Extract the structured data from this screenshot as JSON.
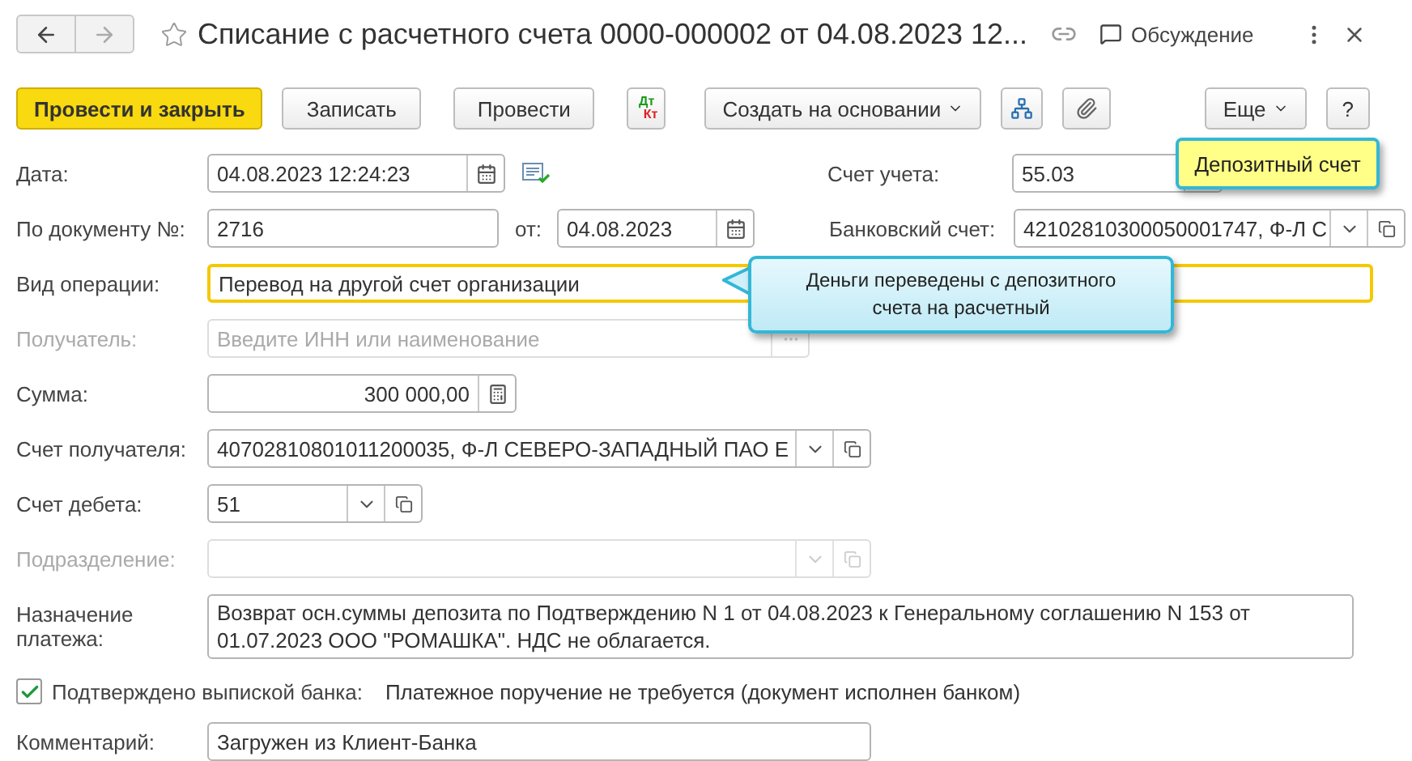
{
  "header": {
    "title": "Списание с расчетного счета 0000-000002 от 04.08.2023 12...",
    "discussion": "Обсуждение"
  },
  "toolbar": [
    {
      "kind": "primary",
      "label": "Провести и закрыть"
    },
    {
      "kind": "text",
      "label": "Записать"
    },
    {
      "kind": "text",
      "label": "Провести"
    },
    {
      "kind": "dtkt",
      "top": "Дт",
      "bottom": "Кт"
    },
    {
      "kind": "menu",
      "label": "Создать на основании"
    },
    {
      "kind": "structure"
    },
    {
      "kind": "clip"
    },
    {
      "kind": "spacer"
    },
    {
      "kind": "menu",
      "label": "Еще"
    },
    {
      "kind": "text",
      "label": "?"
    }
  ],
  "rows": [
    {
      "left": {
        "label": "Дата:",
        "kind": "date",
        "value": "04.08.2023 12:24:23",
        "disabled": false,
        "focused": false
      },
      "right": {
        "label": "Счет учета:",
        "kind": "select",
        "value": "55.03",
        "disabled": false,
        "focused": false
      }
    },
    {
      "left": {
        "label": "По документу №:",
        "kind": "text",
        "value": "2716",
        "disabled": false,
        "focused": false
      },
      "from": {
        "label": "от:",
        "kind": "date",
        "value": "04.08.2023",
        "disabled": false,
        "focused": false
      },
      "right": {
        "label": "Банковский счет:",
        "kind": "lookup",
        "value": "42102810300050001747, Ф-Л С",
        "disabled": false,
        "focused": false
      }
    },
    {
      "left": {
        "label": "Вид операции:",
        "kind": "text",
        "value": "Перевод на другой счет организации",
        "disabled": false,
        "focused": true
      }
    },
    {
      "left": {
        "label": "Получатель:",
        "kind": "more",
        "placeholder": "Введите ИНН или наименование",
        "disabled": true,
        "focused": false
      }
    },
    {
      "left": {
        "label": "Сумма:",
        "kind": "amount",
        "value": "300 000,00",
        "disabled": false,
        "focused": false
      }
    },
    {
      "left": {
        "label": "Счет получателя:",
        "kind": "lookup",
        "value": "40702810801011200035, Ф-Л СЕВЕРО-ЗАПАДНЫЙ ПАО Е",
        "disabled": false,
        "focused": false
      }
    },
    {
      "left": {
        "label": "Счет дебета:",
        "kind": "lookup",
        "value": "51",
        "disabled": false,
        "focused": false
      }
    },
    {
      "left": {
        "label": "Подразделение:",
        "kind": "lookup",
        "disabled": true,
        "focused": false
      }
    }
  ],
  "purpose": {
    "label": "Назначение платежа:",
    "value": "Возврат осн.суммы депозита  по Подтверждению N 1 от 04.08.2023 к Генеральному соглашению N 153 от 01.07.2023 ООО \"РОМАШКА\". НДС не облагается."
  },
  "confirmed": {
    "label": "Подтверждено выпиской банка:",
    "checked": true,
    "note": "Платежное поручение не требуется (документ исполнен банком)"
  },
  "comment": {
    "label": "Комментарий:",
    "value": "Загружен из Клиент-Банка"
  },
  "callouts": [
    {
      "kind": "note",
      "text": "Депозитный счет"
    },
    {
      "kind": "hint",
      "text": "Деньги переведены с депозитного счета на расчетный"
    }
  ]
}
